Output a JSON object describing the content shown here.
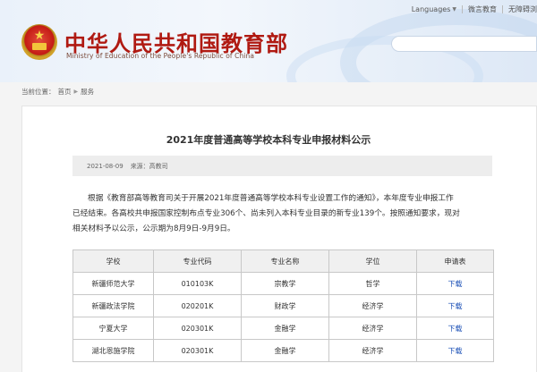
{
  "header": {
    "site_title": "中华人民共和国教育部",
    "site_subtitle": "Ministry of Education of the People's Republic of China",
    "top_links": {
      "language": "Languages",
      "weibo": "微言教育",
      "accessibility": "无障碍浏"
    }
  },
  "breadcrumb": {
    "label": "当前位置：",
    "home": "首页",
    "service": "服务"
  },
  "article": {
    "title": "2021年度普通高等学校本科专业申报材料公示",
    "date": "2021-08-09",
    "source": "来源：高教司",
    "paragraph_lines": [
      "根据《教育部高等教育司关于开展2021年度普通高等学校本科专业设置工作的通知》，本年度专业申报工作",
      "已经结束。各高校共申报国家控制布点专业306个、尚未列入本科专业目录的新专业139个。按照通知要求，现对",
      "相关材料予以公示，公示期为8月9日-9月9日。"
    ]
  },
  "table": {
    "headers": [
      "学校",
      "专业代码",
      "专业名称",
      "学位",
      "申请表"
    ],
    "rows": [
      [
        "新疆师范大学",
        "010103K",
        "宗教学",
        "哲学",
        "下载"
      ],
      [
        "新疆政法学院",
        "020201K",
        "财政学",
        "经济学",
        "下载"
      ],
      [
        "宁夏大学",
        "020301K",
        "金融学",
        "经济学",
        "下载"
      ],
      [
        "湖北恩施学院",
        "020301K",
        "金融学",
        "经济学",
        "下载"
      ]
    ]
  },
  "colors": {
    "title_red": "#b01a12",
    "link_blue": "#1a4fb6",
    "header_bg": "#eaf1fa"
  }
}
